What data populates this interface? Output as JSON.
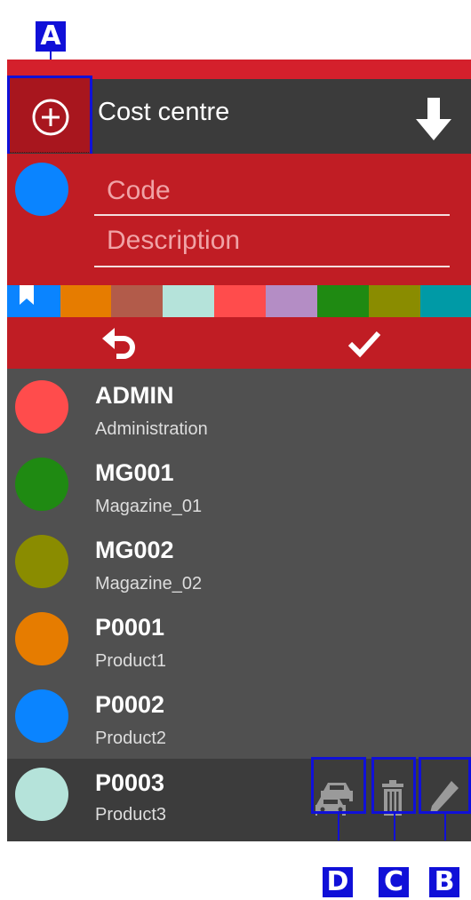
{
  "callouts": {
    "a": "A",
    "b": "B",
    "c": "C",
    "d": "D"
  },
  "header": {
    "title": "Cost centre"
  },
  "editor": {
    "code_placeholder": "Code",
    "description_placeholder": "Description",
    "selected_color": "#0a84ff"
  },
  "palette": [
    "#ffffff",
    "#e67c00",
    "#b25b4a",
    "#b5e3da",
    "#ff4c4c",
    "#b48dc5",
    "#1f8a12",
    "#8a8c00",
    "#009aa6"
  ],
  "items": [
    {
      "code": "ADMIN",
      "description": "Administration",
      "color": "#ff4c4c"
    },
    {
      "code": "MG001",
      "description": "Magazine_01",
      "color": "#1f8a12"
    },
    {
      "code": "MG002",
      "description": "Magazine_02",
      "color": "#8a8c00"
    },
    {
      "code": "P0001",
      "description": "Product1",
      "color": "#e67c00"
    },
    {
      "code": "P0002",
      "description": "Product2",
      "color": "#0a84ff"
    },
    {
      "code": "P0003",
      "description": "Product3",
      "color": "#b5e3da"
    }
  ]
}
